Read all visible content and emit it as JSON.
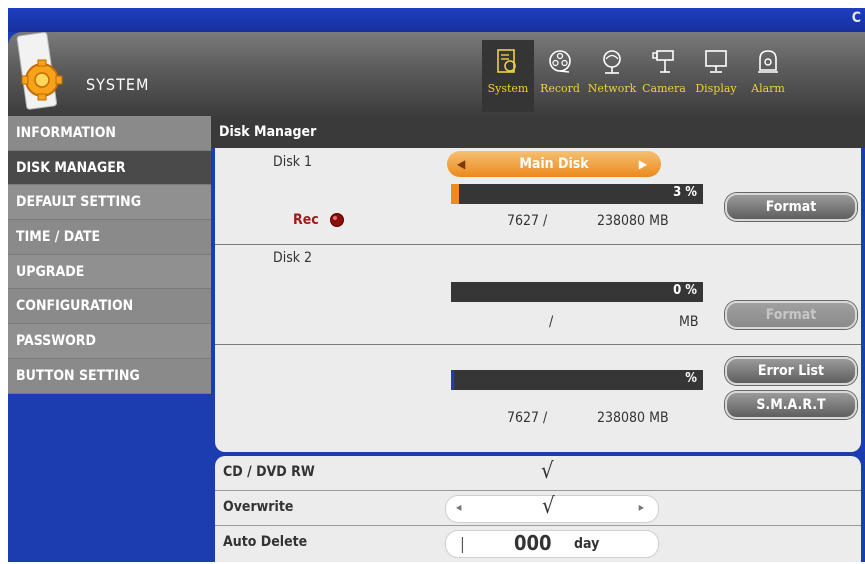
{
  "topbar": {
    "corner_text": "C"
  },
  "header": {
    "title": "SYSTEM"
  },
  "tabs": [
    {
      "label": "System",
      "icon": "system-icon",
      "active": true
    },
    {
      "label": "Record",
      "icon": "record-icon",
      "active": false
    },
    {
      "label": "Network",
      "icon": "network-icon",
      "active": false
    },
    {
      "label": "Camera",
      "icon": "camera-icon",
      "active": false
    },
    {
      "label": "Display",
      "icon": "display-icon",
      "active": false
    },
    {
      "label": "Alarm",
      "icon": "alarm-icon",
      "active": false
    }
  ],
  "sidebar": {
    "items": [
      {
        "label": "INFORMATION"
      },
      {
        "label": "DISK MANAGER"
      },
      {
        "label": "DEFAULT SETTING"
      },
      {
        "label": "TIME / DATE"
      },
      {
        "label": "UPGRADE"
      },
      {
        "label": "CONFIGURATION"
      },
      {
        "label": "PASSWORD"
      },
      {
        "label": "BUTTON SETTING"
      }
    ],
    "active_index": 1
  },
  "panel": {
    "title": "Disk Manager"
  },
  "disk1": {
    "label": "Disk 1",
    "mode": "Main Disk",
    "percent_text": "3 %",
    "usage_fraction": 0.03,
    "rec_label": "Rec",
    "used": "7627 /",
    "total": "238080  MB",
    "format_label": "Format"
  },
  "disk2": {
    "label": "Disk 2",
    "percent_text": "0 %",
    "slash": "/",
    "unit": "MB",
    "format_label": "Format"
  },
  "summary": {
    "percent_text": "%",
    "used": "7627 /",
    "total": "238080  MB",
    "error_list_label": "Error List",
    "smart_label": "S.M.A.R.T"
  },
  "options": {
    "cd_dvd_label": "CD / DVD RW",
    "cd_dvd_value": "√",
    "overwrite_label": "Overwrite",
    "overwrite_value": "√",
    "auto_delete_label": "Auto Delete",
    "auto_delete_value": "000",
    "auto_delete_unit": "day"
  },
  "colors": {
    "accent": "#f08a20",
    "tab_text": "#f0d040",
    "background": "#1b3db0"
  }
}
